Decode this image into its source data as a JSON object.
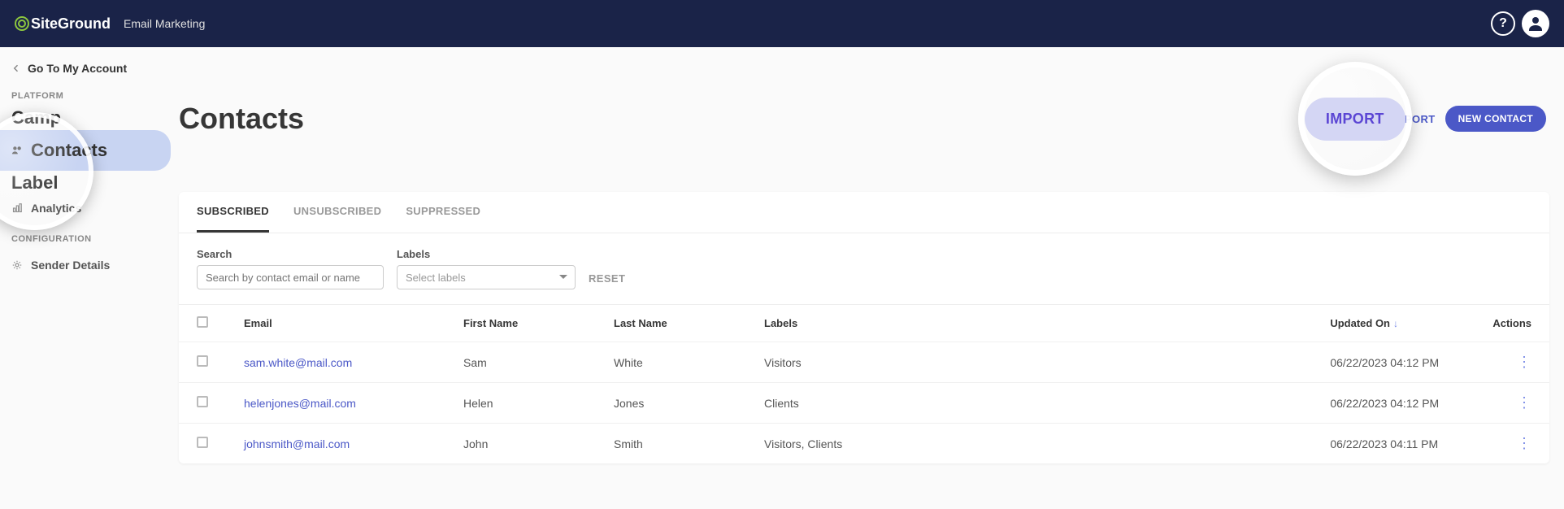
{
  "header": {
    "logo_text": "SiteGround",
    "app_name": "Email Marketing"
  },
  "sidebar": {
    "back": "Go To My Account",
    "sections": {
      "platform": "PLATFORM",
      "configuration": "CONFIGURATION"
    },
    "items": {
      "campaigns_partial": "Camp",
      "contacts": "Contacts",
      "labels_partial": "Label",
      "analytics": "Analytics",
      "sender_details": "Sender Details"
    }
  },
  "page": {
    "title": "Contacts",
    "import": "IMPORT",
    "export": "XPORT",
    "new_contact": "NEW CONTACT"
  },
  "tabs": {
    "subscribed": "SUBSCRIBED",
    "unsubscribed": "UNSUBSCRIBED",
    "suppressed": "SUPPRESSED"
  },
  "filters": {
    "search_label": "Search",
    "search_placeholder": "Search by contact email or name",
    "labels_label": "Labels",
    "labels_placeholder": "Select labels",
    "reset": "RESET"
  },
  "table": {
    "headers": {
      "email": "Email",
      "first_name": "First Name",
      "last_name": "Last Name",
      "labels": "Labels",
      "updated_on": "Updated On",
      "actions": "Actions"
    },
    "rows": [
      {
        "email": "sam.white@mail.com",
        "first_name": "Sam",
        "last_name": "White",
        "labels": "Visitors",
        "updated_on": "06/22/2023 04:12 PM"
      },
      {
        "email": "helenjones@mail.com",
        "first_name": "Helen",
        "last_name": "Jones",
        "labels": "Clients",
        "updated_on": "06/22/2023 04:12 PM"
      },
      {
        "email": "johnsmith@mail.com",
        "first_name": "John",
        "last_name": "Smith",
        "labels": "Visitors, Clients",
        "updated_on": "06/22/2023 04:11 PM"
      }
    ]
  }
}
